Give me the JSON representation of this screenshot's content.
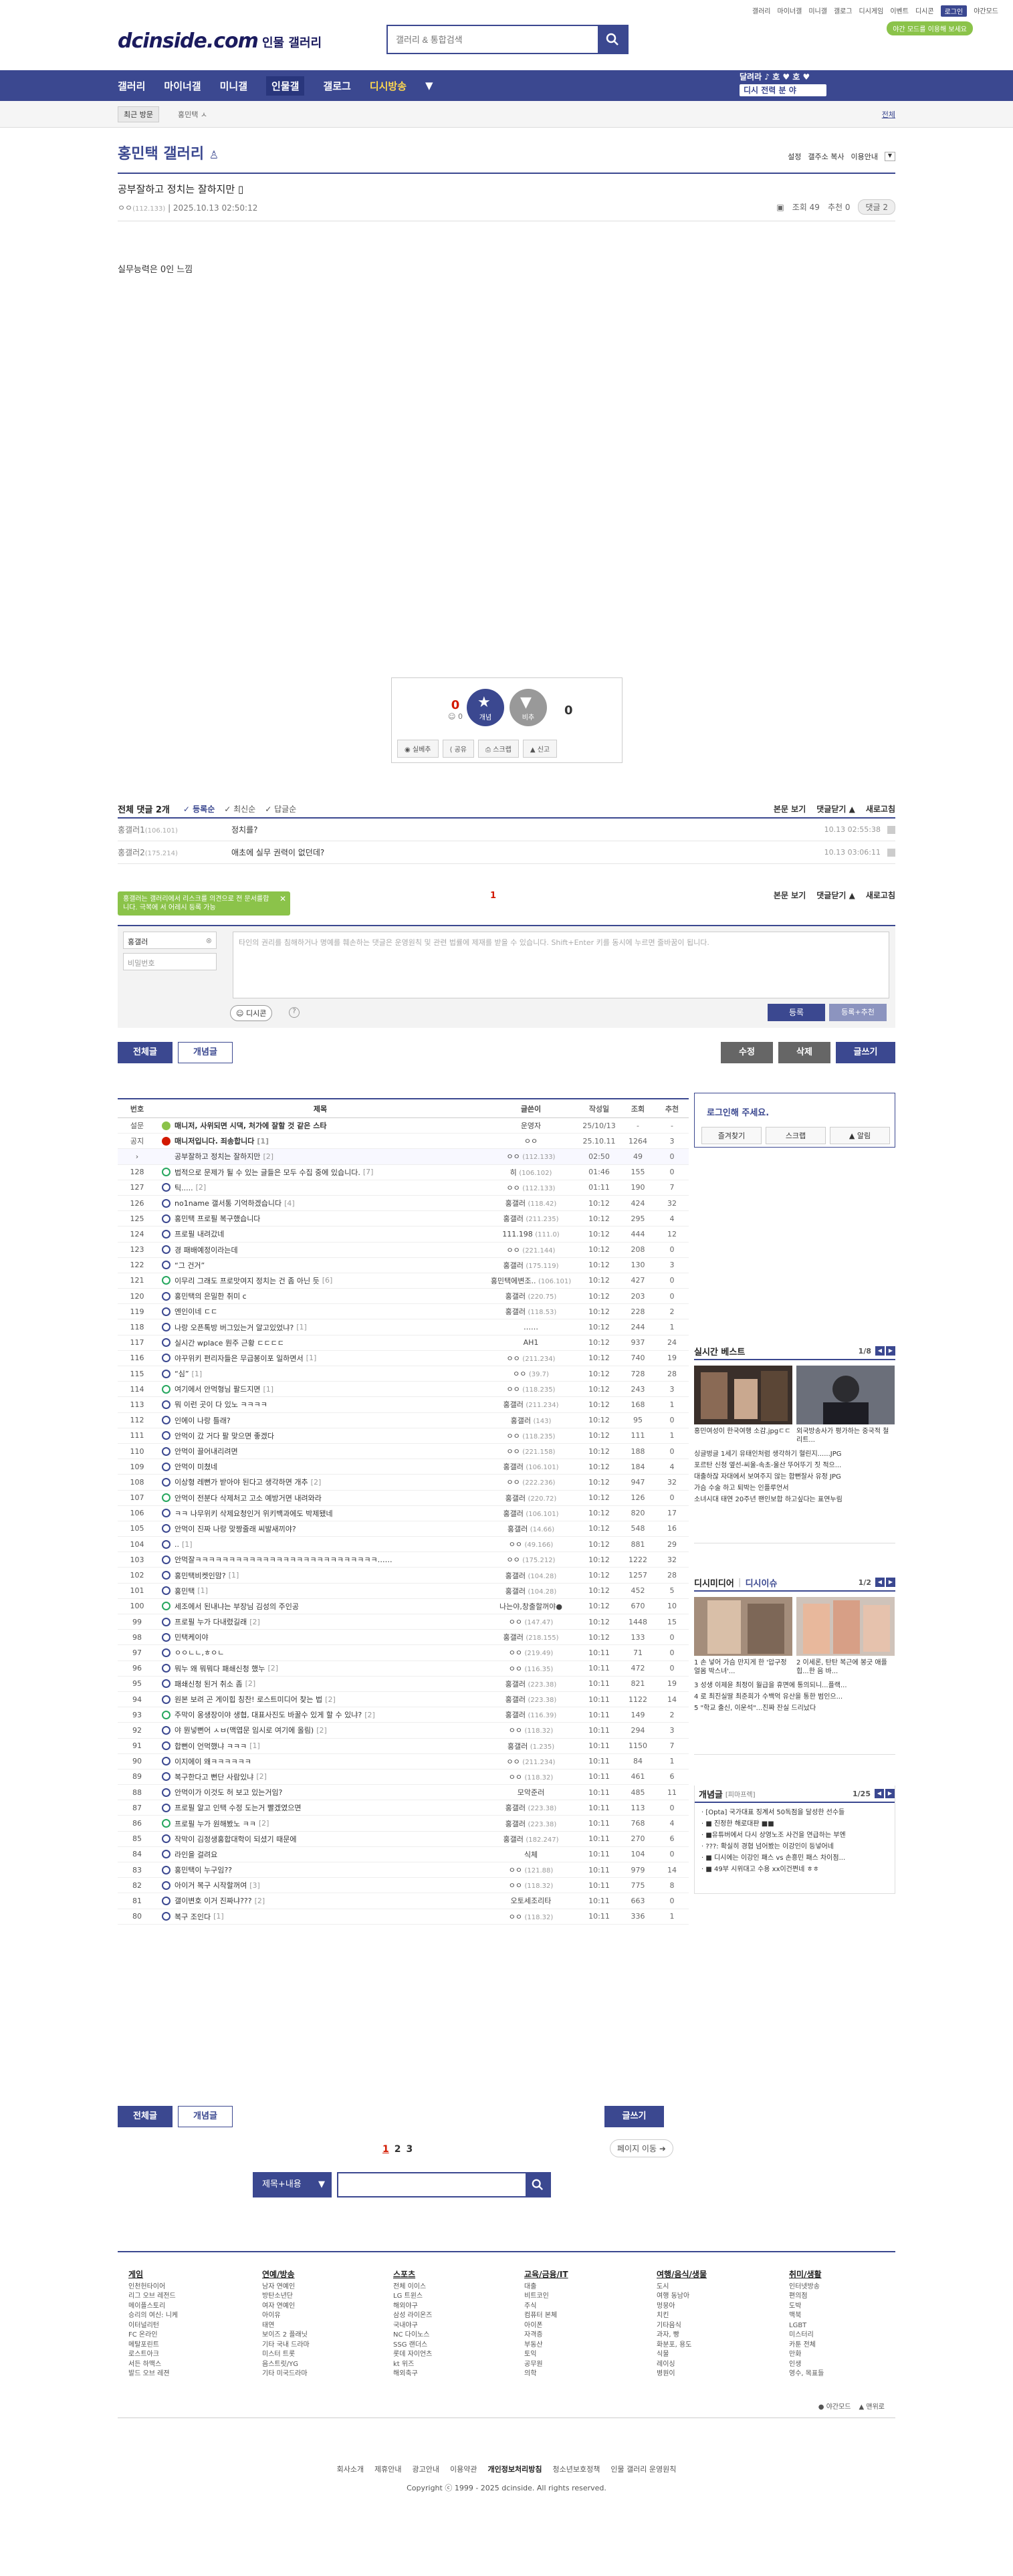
{
  "top": {
    "links": [
      "갤러리",
      "마이너갤",
      "미니갤",
      "갤로그",
      "디시게임",
      "이벤트",
      "디시콘",
      "로그인",
      "야간모드"
    ],
    "darkmode": "야간 모드를 이용해 보세요",
    "logo": "dcinside.com",
    "logo_sub": "인물 갤러리",
    "search_placeholder": "갤러리 & 통합검색"
  },
  "gnb": {
    "items": [
      "갤러리",
      "마이너갤",
      "미니갤",
      "인물갤",
      "갤로그",
      "디시방송"
    ],
    "right_1": "달려라 ♪ 호 ♥ 호 ♥",
    "right_2": "디시 전력 분 야"
  },
  "visit": {
    "tag": "최근 방문",
    "item": "홍민택 ㅅ",
    "all": "전체"
  },
  "gallery": {
    "title": "홍민택 갤러리",
    "tools": [
      "설정",
      "갤주소 복사",
      "이용안내"
    ]
  },
  "post": {
    "title": "공부잘하고 정치는 잘하지만",
    "writer": "ㅇㅇ",
    "ip": "(112.133)",
    "date": "2025.10.13 02:50:12",
    "views": "조회 49",
    "recommend": "추천 0",
    "comments": "댓글 2",
    "body": "실무능력은 0인 느낌"
  },
  "recommend": {
    "up": "0",
    "fix": "0",
    "up_label": "개념",
    "down_label": "비추",
    "down": "0",
    "actions": [
      "실베추",
      "공유",
      "스크랩",
      "신고"
    ]
  },
  "comments": {
    "total": "전체 댓글 2개",
    "sort": [
      "등록순",
      "최신순",
      "답글순"
    ],
    "right": [
      "본문 보기",
      "댓글닫기",
      "새로고침"
    ],
    "rows": [
      {
        "nick": "홍갤러1",
        "ip": "(106.101)",
        "text": "정치를?",
        "date": "10.13 02:55:38"
      },
      {
        "nick": "홍갤러2",
        "ip": "(175.214)",
        "text": "애초에 실무 권력이 없던데?",
        "date": "10.13 03:06:11"
      }
    ],
    "page": "1",
    "tooltip": "홍갤러는 갤러리에서 리스크를 의견으로 전 문서를합니다. 극복에 서 어레시 등록 가능",
    "nick_value": "홍갤러",
    "pw_placeholder": "비밀번호",
    "textarea": "타인의 권리를 침해하거나 명예를 훼손하는 댓글은 운영원칙 및 관련 법률에 제재를 받을 수 있습니다. Shift+Enter 키를 동시에 누르면 줄바꿈이 됩니다.",
    "dccon": "디시콘",
    "submit": "등록",
    "submit2": "등록+추천"
  },
  "buttons": {
    "all": "전체글",
    "concept": "개념글",
    "edit": "수정",
    "delete": "삭제",
    "write": "글쓰기"
  },
  "list": {
    "headers": [
      "번호",
      "제목",
      "글쓴이",
      "작성일",
      "조회",
      "추천"
    ],
    "rows": [
      {
        "no": "설문",
        "t": "매니저, 사위되면 시댁, 처가에 잘할 것 같은 스타",
        "w": "운영자",
        "d": "25/10/13",
        "v": "-",
        "r": "-",
        "k": "survey"
      },
      {
        "no": "공지",
        "t": "매니저입니다. 죄송합니다",
        "c": "[1]",
        "w": "ㅇㅇ",
        "d": "25.10.11",
        "v": "1264",
        "r": "3",
        "k": "notice"
      },
      {
        "no": "›",
        "t": "공부잘하고 정치는 잘하지만",
        "c": "[2]",
        "w": "ㅇㅇ",
        "ip": "(112.133)",
        "d": "02:50",
        "v": "49",
        "r": "0",
        "k": "cur"
      },
      {
        "no": "128",
        "t": "법적으로 문제가 될 수 있는 글들은 모두 수집 중에 있습니다.",
        "c": "[7]",
        "w": "히",
        "ip": "(106.102)",
        "d": "01:46",
        "v": "155",
        "r": "0"
      },
      {
        "no": "127",
        "t": "틱.....",
        "c": "[2]",
        "w": "ㅇㅇ",
        "ip": "(112.133)",
        "d": "01:11",
        "v": "190",
        "r": "7"
      },
      {
        "no": "126",
        "t": "no1name 갤서통 기억하겠습니다",
        "c": "[4]",
        "w": "홍갤러",
        "ip": "(118.42)",
        "d": "10:12",
        "v": "424",
        "r": "32"
      },
      {
        "no": "125",
        "t": "홍민택 프로필 복구했습니다",
        "w": "홍갤러",
        "ip": "(211.235)",
        "d": "10:12",
        "v": "295",
        "r": "4"
      },
      {
        "no": "124",
        "t": "프로필 내려갔네",
        "w": "111.198",
        "ip": "(111.0)",
        "d": "10:12",
        "v": "444",
        "r": "12"
      },
      {
        "no": "123",
        "t": "경 패배예정이라는데",
        "w": "ㅇㅇ",
        "ip": "(221.144)",
        "d": "10:12",
        "v": "208",
        "r": "0"
      },
      {
        "no": "122",
        "t": "“그 건거”",
        "w": "홍갤러",
        "ip": "(175.119)",
        "d": "10:12",
        "v": "130",
        "r": "3"
      },
      {
        "no": "121",
        "t": "이무리 그래도 프로맛여지 정치는 건 좀 아닌 듯",
        "c": "[6]",
        "w": "홍민택에변조..",
        "ip": "(106.101)",
        "d": "10:12",
        "v": "427",
        "r": "0"
      },
      {
        "no": "120",
        "t": "홍민택의 은밀한 취미 c",
        "w": "홍갤러",
        "ip": "(220.75)",
        "d": "10:12",
        "v": "203",
        "r": "0"
      },
      {
        "no": "119",
        "t": "엔인이네 ㄷㄷ",
        "w": "홍갤러",
        "ip": "(118.53)",
        "d": "10:12",
        "v": "228",
        "r": "2"
      },
      {
        "no": "118",
        "t": "나랑 오픈톡방 버그있는거 알고있었냐?",
        "c": "[1]",
        "w": "……",
        "d": "10:12",
        "v": "244",
        "r": "1"
      },
      {
        "no": "117",
        "t": "실시간 wplace 뭔주 근황 ㄷㄷㄷㄷ",
        "w": "AH1",
        "d": "10:12",
        "v": "937",
        "r": "24"
      },
      {
        "no": "116",
        "t": "야꾸위키 편리자들은 무급봉이포 일하면서",
        "c": "[1]",
        "w": "ㅇㅇ",
        "ip": "(211.234)",
        "d": "10:12",
        "v": "740",
        "r": "19"
      },
      {
        "no": "115",
        "t": "“심”",
        "c": "[1]",
        "w": "ㅇㅇ",
        "ip": "(39.7)",
        "d": "10:12",
        "v": "728",
        "r": "28"
      },
      {
        "no": "114",
        "t": "여기에서 안먹형님 팔드지면",
        "c": "[1]",
        "w": "ㅇㅇ",
        "ip": "(118.235)",
        "d": "10:12",
        "v": "243",
        "r": "3"
      },
      {
        "no": "113",
        "t": "뭐 이런 곳이 다 있노 ㅋㅋㅋㅋ",
        "w": "홍갤러",
        "ip": "(211.234)",
        "d": "10:12",
        "v": "168",
        "r": "1"
      },
      {
        "no": "112",
        "t": "인에이 나랑 틀래?",
        "w": "홍갤러",
        "ip": "(143)",
        "d": "10:12",
        "v": "95",
        "r": "0"
      },
      {
        "no": "111",
        "t": "안먹이 갔 거다 팔 맞으면 좋겠다",
        "w": "ㅇㅇ",
        "ip": "(118.235)",
        "d": "10:12",
        "v": "111",
        "r": "1"
      },
      {
        "no": "110",
        "t": "안먹이 끌어내리려면",
        "w": "ㅇㅇ",
        "ip": "(221.158)",
        "d": "10:12",
        "v": "188",
        "r": "0"
      },
      {
        "no": "109",
        "t": "안먹이 미쳤네",
        "w": "홍갤러",
        "ip": "(106.101)",
        "d": "10:12",
        "v": "184",
        "r": "4"
      },
      {
        "no": "108",
        "t": "이상형 레뻔가 받아야 된다고 생각하면 개추",
        "c": "[2]",
        "w": "ㅇㅇ",
        "ip": "(222.236)",
        "d": "10:12",
        "v": "947",
        "r": "32"
      },
      {
        "no": "107",
        "t": "안먹이 전분다 삭제처고 고소 예방거면 내려와라",
        "w": "홍갤러",
        "ip": "(220.72)",
        "d": "10:12",
        "v": "126",
        "r": "0"
      },
      {
        "no": "106",
        "t": "ㅋㅋ 나무위키 삭제요청인거 위키백과에도 박제됐네",
        "w": "홍갤러",
        "ip": "(106.101)",
        "d": "10:12",
        "v": "820",
        "r": "17"
      },
      {
        "no": "105",
        "t": "안먹이 진짜 나랑 맞짱줄래 씨발새끼야?",
        "w": "홍갤러",
        "ip": "(14.66)",
        "d": "10:12",
        "v": "548",
        "r": "16"
      },
      {
        "no": "104",
        "t": "..",
        "c": "[1]",
        "w": "ㅇㅇ",
        "ip": "(49.166)",
        "d": "10:12",
        "v": "881",
        "r": "29"
      },
      {
        "no": "103",
        "t": "안먹잘ㅋㅋㅋㅋㅋㅋㅋㅋㅋㅋㅋㅋㅋㅋㅋㅋㅋㅋㅋㅋㅋㅋㅋㅋㅋㅋㅋ……",
        "w": "ㅇㅇ",
        "ip": "(175.212)",
        "d": "10:12",
        "v": "1222",
        "r": "32"
      },
      {
        "no": "102",
        "t": "홍민택비켓인맘?",
        "c": "[1]",
        "w": "홍갤러",
        "ip": "(104.28)",
        "d": "10:12",
        "v": "1257",
        "r": "28"
      },
      {
        "no": "101",
        "t": "홍민택",
        "c": "[1]",
        "w": "홍갤러",
        "ip": "(104.28)",
        "d": "10:12",
        "v": "452",
        "r": "5"
      },
      {
        "no": "100",
        "t": "세조에서 된내냐는 부장님 김성의 주인공",
        "w": "나는야,창출할꺼야●",
        "d": "10:12",
        "v": "670",
        "r": "10"
      },
      {
        "no": "99",
        "t": "프로필 누가 다내렸길래",
        "c": "[2]",
        "w": "ㅇㅇ",
        "ip": "(147.47)",
        "d": "10:12",
        "v": "1448",
        "r": "15"
      },
      {
        "no": "98",
        "t": "민택케이야",
        "w": "홍갤러",
        "ip": "(218.155)",
        "d": "10:12",
        "v": "133",
        "r": "0"
      },
      {
        "no": "97",
        "t": "ㅇㅇㄴㄴ,ㅎㅇㄴ",
        "w": "ㅇㅇ",
        "ip": "(219.49)",
        "d": "10:11",
        "v": "71",
        "r": "0"
      },
      {
        "no": "96",
        "t": "뭐누 왜 뭐뭐다 패쇄신청 했누",
        "c": "[2]",
        "w": "ㅇㅇ",
        "ip": "(116.35)",
        "d": "10:11",
        "v": "472",
        "r": "0"
      },
      {
        "no": "95",
        "t": "패쇄신청 된거 취소 좀",
        "c": "[2]",
        "w": "홍갤러",
        "ip": "(223.38)",
        "d": "10:11",
        "v": "821",
        "r": "19"
      },
      {
        "no": "94",
        "t": "원본 보려 곤 게이힙 칭찬! 로스트미디어 찾는 법",
        "c": "[2]",
        "w": "홍갤러",
        "ip": "(223.38)",
        "d": "10:11",
        "v": "1122",
        "r": "14"
      },
      {
        "no": "93",
        "t": "주막이 옹생장이야 생협, 대표사진도 바꿀수 있게 할 수 있냐?",
        "c": "[2]",
        "w": "홍갤러",
        "ip": "(116.39)",
        "d": "10:11",
        "v": "149",
        "r": "2"
      },
      {
        "no": "92",
        "t": "야 뭔넣뻔어 ㅅㅂ(맥엽문 임시로 여기에 올림)",
        "c": "[2]",
        "w": "ㅇㅇ",
        "ip": "(118.32)",
        "d": "10:11",
        "v": "294",
        "r": "3"
      },
      {
        "no": "91",
        "t": "합뻔이 언먹했냐 ㅋㅋㅋ",
        "c": "[1]",
        "w": "홍갤러",
        "ip": "(1.235)",
        "d": "10:11",
        "v": "1150",
        "r": "7"
      },
      {
        "no": "90",
        "t": "이지에이 왜ㅋㅋㅋㅋㅋㅋ",
        "w": "ㅇㅇ",
        "ip": "(211.234)",
        "d": "10:11",
        "v": "84",
        "r": "1"
      },
      {
        "no": "89",
        "t": "복구한다고 뻔단 사람있냐",
        "c": "[2]",
        "w": "ㅇㅇ",
        "ip": "(118.32)",
        "d": "10:11",
        "v": "461",
        "r": "6"
      },
      {
        "no": "88",
        "t": "안먹이가 이것도 허 보고 있는거임?",
        "w": "모악준러",
        "d": "10:11",
        "v": "485",
        "r": "11"
      },
      {
        "no": "87",
        "t": "프로필 알고 인택 수정 도는거 빨겠였으면",
        "w": "홍갤러",
        "ip": "(223.38)",
        "d": "10:11",
        "v": "113",
        "r": "0"
      },
      {
        "no": "86",
        "t": "프로필 누가 원해봤노 ㅋㅋ",
        "c": "[2]",
        "w": "홍갤러",
        "ip": "(223.38)",
        "d": "10:11",
        "v": "768",
        "r": "4"
      },
      {
        "no": "85",
        "t": "작막이 김정생홍합대학이 되셨기 때문에",
        "w": "홍갤러",
        "ip": "(182.247)",
        "d": "10:11",
        "v": "270",
        "r": "6"
      },
      {
        "no": "84",
        "t": "라인을 걸려요",
        "w": "식체",
        "d": "10:11",
        "v": "104",
        "r": "0"
      },
      {
        "no": "83",
        "t": "홍민택이 누구임??",
        "w": "ㅇㅇ",
        "ip": "(121.88)",
        "d": "10:11",
        "v": "979",
        "r": "14"
      },
      {
        "no": "82",
        "t": "아이거 복구 시작할꺼여",
        "c": "[3]",
        "w": "ㅇㅇ",
        "ip": "(118.32)",
        "d": "10:11",
        "v": "775",
        "r": "8"
      },
      {
        "no": "81",
        "t": "갤이변호 이거 진짜냐???",
        "c": "[2]",
        "w": "오토세조리타",
        "d": "10:11",
        "v": "663",
        "r": "0"
      },
      {
        "no": "80",
        "t": "복구 조인다",
        "c": "[1]",
        "w": "ㅇㅇ",
        "ip": "(118.32)",
        "d": "10:11",
        "v": "336",
        "r": "1"
      }
    ]
  },
  "side": {
    "login_title": "로그인해 주세요.",
    "login_btns": [
      "즐겨찾기",
      "스크랩",
      "알림"
    ],
    "best": {
      "title": "실시간 베스트",
      "page": "1/8",
      "caps": [
        "홍민여성이 한국여행 소감.jpgㄷㄷ",
        "외국방송사가 평가하는 중국적 철리트..."
      ],
      "items": [
        "싱글벙글 1세기 유태인처럼 생각하기 혈린지......JPG",
        "포르탄 신청 옆선-씨울-속초-울산 뚜어뚜기 짓 적으...",
        "대출하잖 자대에서 보여주지 않는 합뻔잘사 유정 JPG",
        "가슴 수술 하고 퇴박는 인플루언서",
        "소녀시대 태연 20주년 팬인보합 하고싶다는 표연누림"
      ]
    },
    "dc": {
      "title": "디시미디어",
      "title2": "디시이슈",
      "page": "1/2",
      "caps": [
        "1 손 넣어 가슴 만지게 한 '압구정 얼몸 박스녀'...",
        "2 이세론, 탄탄 복근에 봉긋 애플힙...한 음 바..."
      ],
      "items": [
        "3 성생 이제윤 최정이 월급을 휴면에 통의되니...플랙...",
        "4 로 최진실딸 최준희가 수백억 유산을 통한 범인으...",
        "5 \"학교 출신, 이운석\"...진짜 잔실 드리났다"
      ]
    },
    "concept": {
      "title": "개념글",
      "sub": "[피마프렉]",
      "page": "1/25",
      "items": [
        "[Opta] 국가대표 징계서 50독점을 달성한 선수들",
        "■ 진정한 해로대판 ■■",
        "■유튜버에서 다시 상영노조 사건을 연급하는 부엔",
        "???: 확실히 경협 넘어봤는 이강인이 등넣어네",
        "■ 디시에는 이강인 패스 vs 손흥민 패스 차이점...",
        "■ 49부 시위대고 수용 xx이건쩐네 ㅎㅎ"
      ]
    }
  },
  "paging": {
    "pages": [
      "1",
      "2",
      "3"
    ],
    "move": "페이지 이동"
  },
  "bsearch": {
    "select": "제목+내용"
  },
  "footer": {
    "cols": [
      {
        "h": "게임",
        "items": [
          "인천헌타이어",
          "리그 오브 레전드",
          "메이플스토리",
          "승리의 여신: 니케",
          "이터널리턴",
          "FC 온라인",
          "메탈포린트",
          "로스트아크",
          "서든 하맥스",
          "발드 오브 레젼"
        ]
      },
      {
        "h": "연예/방송",
        "items": [
          "남자 연예인",
          "방탄소년단",
          "여자 연예인",
          "아이유",
          "태연",
          "보이즈 2 플래닛",
          "기타 국내 드라마",
          "미스터 트롯",
          "음스트릿/YG",
          "기타 미국드라마"
        ]
      },
      {
        "h": "스포츠",
        "items": [
          "전체 이이스",
          "LG 트윈스",
          "해외야구",
          "삼성 라이온즈",
          "국내야구",
          "NC 다이노스",
          "SSG 랜더스",
          "롯데 자이언츠",
          "kt 위즈",
          "해외축구"
        ]
      },
      {
        "h": "교육/금융/IT",
        "items": [
          "대출",
          "비트코인",
          "주식",
          "컴퓨터 본체",
          "아이폰",
          "자격증",
          "부동산",
          "토익",
          "공무원",
          "의학"
        ]
      },
      {
        "h": "여행/음식/생물",
        "items": [
          "도시",
          "여행 동남아",
          "멍뭉아",
          "치킨",
          "기타음식",
          "과자, 빵",
          "화분포, 용도",
          "식물",
          "레이싱",
          "병원이"
        ]
      },
      {
        "h": "취미/생활",
        "items": [
          "인터넷방송",
          "편의점",
          "도박",
          "맥북",
          "LGBT",
          "미스터리",
          "카툰 전체",
          "만화",
          "인생",
          "영수, 목표들"
        ]
      }
    ],
    "mode": [
      "야간모드",
      "맨위로"
    ],
    "links": [
      "회사소개",
      "제휴안내",
      "광고안내",
      "이용약관",
      "개인정보처리방침",
      "청소년보호정책",
      "인물 갤러리 운영원칙"
    ],
    "copyright": "Copyright ⓒ 1999 - 2025 dcinside. All rights reserved."
  },
  "colors": {
    "brand": "#3b4890",
    "accent": "#d31900",
    "green": "#8bc34a"
  }
}
